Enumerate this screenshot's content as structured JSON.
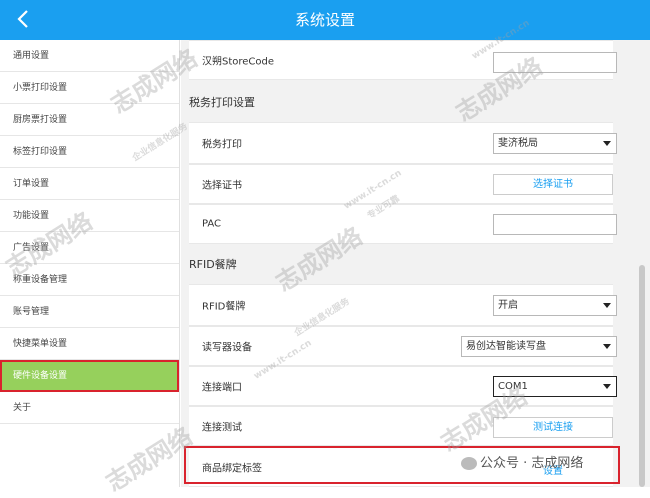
{
  "header": {
    "title": "系统设置"
  },
  "sidebar": {
    "items": [
      {
        "label": "通用设置"
      },
      {
        "label": "小票打印设置"
      },
      {
        "label": "厨房票打设置"
      },
      {
        "label": "标签打印设置"
      },
      {
        "label": "订单设置"
      },
      {
        "label": "功能设置"
      },
      {
        "label": "广告设置"
      },
      {
        "label": "称重设备管理"
      },
      {
        "label": "账号管理"
      },
      {
        "label": "快捷菜单设置"
      },
      {
        "label": "硬件设备设置"
      },
      {
        "label": "关于"
      }
    ],
    "active_index": 10
  },
  "main": {
    "store_code": {
      "label": "汉朔StoreCode",
      "value": ""
    },
    "tax_section": "税务打印设置",
    "tax_print": {
      "label": "税务打印",
      "value": "斐济税局"
    },
    "cert": {
      "label": "选择证书",
      "button": "选择证书"
    },
    "pac": {
      "label": "PAC",
      "value": ""
    },
    "rfid_section": "RFID餐牌",
    "rfid": {
      "label": "RFID餐牌",
      "value": "开启"
    },
    "reader": {
      "label": "读写器设备",
      "value": "易创达智能读写盘"
    },
    "port": {
      "label": "连接端口",
      "value": "COM1"
    },
    "test": {
      "label": "连接测试",
      "button": "测试连接"
    },
    "bind": {
      "label": "商品绑定标签",
      "button": "设置"
    }
  },
  "watermark": {
    "brand": "志成网络",
    "url": "www.it-cn.cn",
    "slogan": "企业信息化服务",
    "slogan2": "专业可靠",
    "wechat": "公众号 · 志成网络"
  },
  "colors": {
    "header": "#1a9ff0",
    "active": "#96d05c",
    "highlight": "#d9232d"
  }
}
